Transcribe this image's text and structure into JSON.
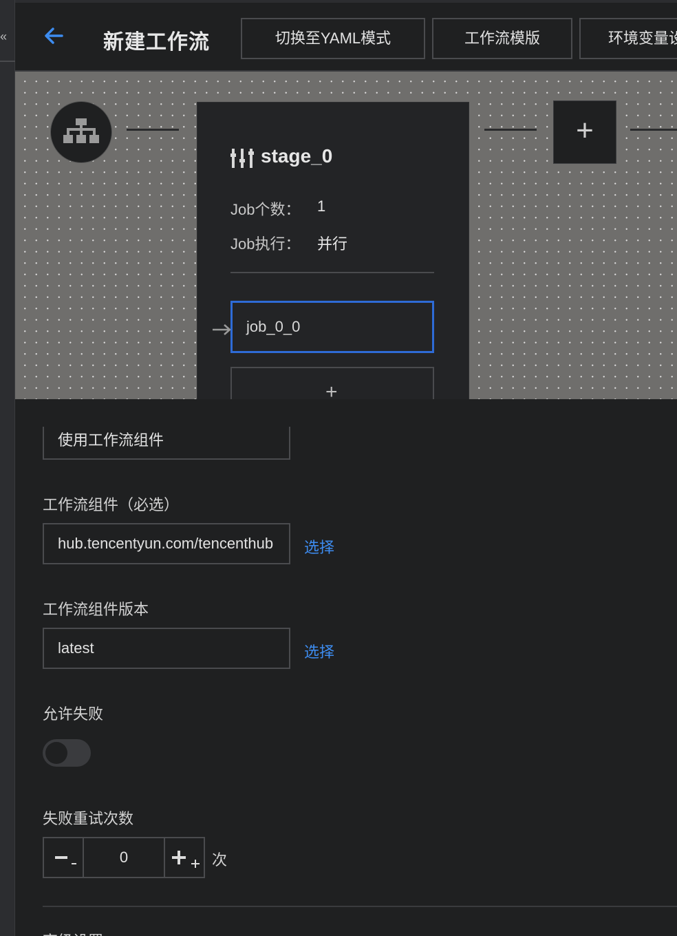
{
  "header": {
    "title": "新建工作流",
    "buttons": [
      "切换至YAML模式",
      "工作流模版",
      "环境变量设"
    ]
  },
  "canvas": {
    "stage": {
      "name": "stage_0",
      "job_count_label": "Job个数：",
      "job_count": "1",
      "job_exec_label": "Job执行：",
      "job_exec": "并行",
      "jobs": [
        "job_0_0"
      ],
      "add_job_symbol": "+"
    },
    "add_stage_symbol": "+"
  },
  "form": {
    "component_mode_value": "使用工作流组件",
    "component_label": "工作流组件（必选）",
    "component_value": "hub.tencentyun.com/tencenthub",
    "component_select": "选择",
    "version_label": "工作流组件版本",
    "version_value": "latest",
    "version_select": "选择",
    "allow_fail_label": "允许失败",
    "allow_fail": false,
    "retry_label": "失败重试次数",
    "retry_value": "0",
    "retry_unit": "次",
    "next_section": "高级设置"
  },
  "colors": {
    "accent": "#3d8cf0",
    "job_border": "#2e6bd6",
    "canvas_bg": "#6f6e6c",
    "panel_bg": "#1f2021"
  }
}
